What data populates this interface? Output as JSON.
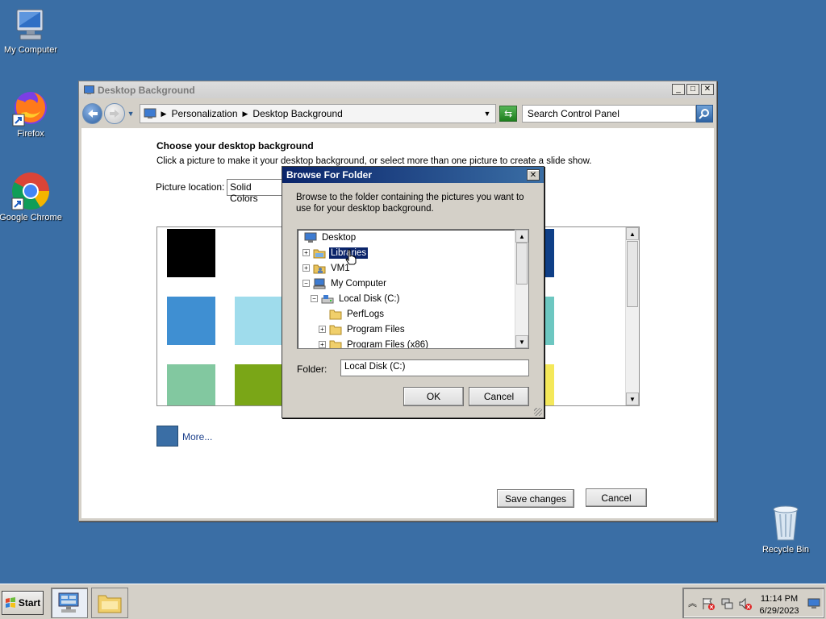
{
  "desktop": {
    "icons": [
      {
        "label": "My Computer",
        "icon": "monitor-icon"
      },
      {
        "label": "Firefox",
        "icon": "firefox-icon"
      },
      {
        "label": "Google Chrome",
        "icon": "chrome-icon"
      },
      {
        "label": "Recycle Bin",
        "icon": "recycle-bin-icon"
      }
    ],
    "background_color": "#3a6ea5"
  },
  "window": {
    "title": "Desktop Background",
    "controls": {
      "minimize": "_",
      "maximize": "□",
      "close": "✕"
    },
    "breadcrumb": [
      "Personalization",
      "Desktop Background"
    ],
    "search_placeholder": "Search Control Panel",
    "heading": "Choose your desktop background",
    "subtext": "Click a picture to make it your desktop background, or select more than one picture to create a slide show.",
    "picture_location_label": "Picture location:",
    "picture_location_value": "Solid Colors",
    "swatch_colors": [
      "#000000",
      "#3f8fd2",
      "#9fdcec",
      "#82c8a0",
      "#7aa617",
      "#0f3f87",
      "#6dc7c1",
      "#f4e85a"
    ],
    "more_label": "More...",
    "save_label": "Save changes",
    "cancel_label": "Cancel"
  },
  "dialog": {
    "title": "Browse For Folder",
    "close": "✕",
    "description": "Browse to the folder containing the pictures you want to use for your desktop background.",
    "tree": [
      {
        "label": "Desktop",
        "expander": "",
        "icon": "desktop-icon",
        "level": 0
      },
      {
        "label": "Libraries",
        "expander": "+",
        "icon": "library-icon",
        "level": 0,
        "selected": true
      },
      {
        "label": "VM1",
        "expander": "+",
        "icon": "user-folder-icon",
        "level": 0
      },
      {
        "label": "My Computer",
        "expander": "−",
        "icon": "computer-icon",
        "level": 0
      },
      {
        "label": "Local Disk (C:)",
        "expander": "−",
        "icon": "drive-icon",
        "level": 1
      },
      {
        "label": "PerfLogs",
        "expander": "",
        "icon": "folder-icon",
        "level": 2
      },
      {
        "label": "Program Files",
        "expander": "+",
        "icon": "folder-icon",
        "level": 2
      },
      {
        "label": "Program Files (x86)",
        "expander": "+",
        "icon": "folder-icon",
        "level": 2
      }
    ],
    "folder_label": "Folder:",
    "folder_value": "Local Disk (C:)",
    "ok_label": "OK",
    "cancel_label": "Cancel"
  },
  "taskbar": {
    "start_label": "Start",
    "clock_time": "11:14 PM",
    "clock_date": "6/29/2023"
  }
}
